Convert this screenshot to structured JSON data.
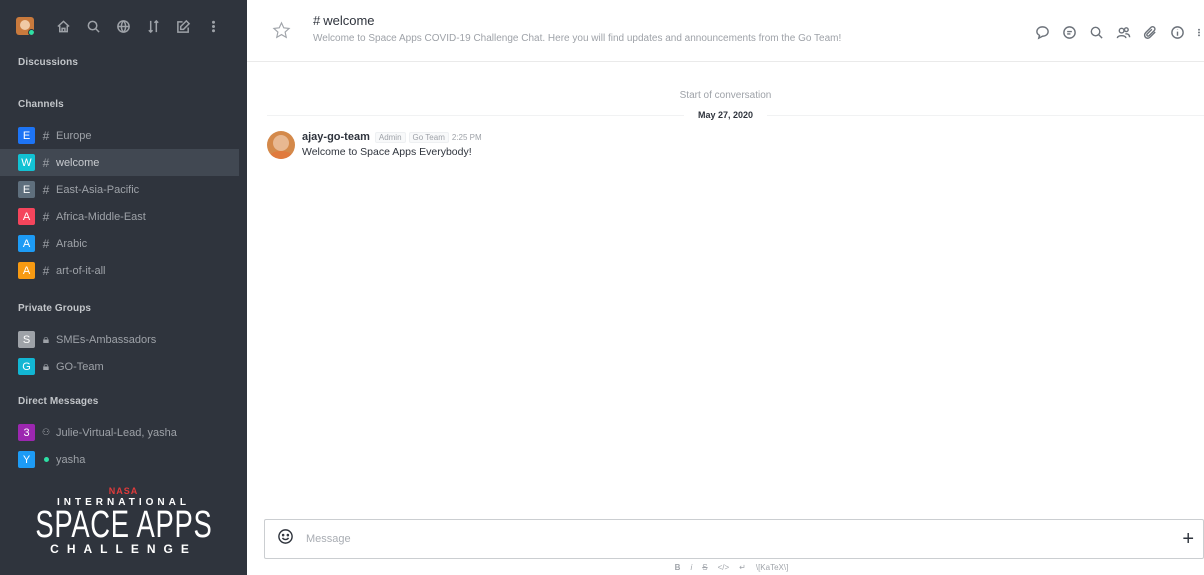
{
  "sidebar": {
    "sections": {
      "discussions": "Discussions",
      "channels": "Channels",
      "private_groups": "Private Groups",
      "direct_messages": "Direct Messages"
    },
    "channels": [
      {
        "letter": "E",
        "color": "#1d74f5",
        "name": "Europe"
      },
      {
        "letter": "W",
        "color": "#12c2d3",
        "name": "welcome"
      },
      {
        "letter": "E",
        "color": "#5f6f7d",
        "name": "East-Asia-Pacific"
      },
      {
        "letter": "A",
        "color": "#f5455c",
        "name": "Africa-Middle-East"
      },
      {
        "letter": "A",
        "color": "#1d9bf5",
        "name": "Arabic"
      },
      {
        "letter": "A",
        "color": "#f79a12",
        "name": "art-of-it-all"
      }
    ],
    "private_groups": [
      {
        "letter": "S",
        "color": "#9ea2a8",
        "name": "SMEs-Ambassadors"
      },
      {
        "letter": "G",
        "color": "#12b6d3",
        "name": "GO-Team"
      }
    ],
    "direct_messages": [
      {
        "letter": "3",
        "color": "#9c27b0",
        "name": "Julie-Virtual-Lead, yasha"
      },
      {
        "letter": "Y",
        "color": "#1d9bf5",
        "name": "yasha"
      }
    ],
    "logo": {
      "nasa": "NASA",
      "international": "INTERNATIONAL",
      "space_apps": "SPACE APPS",
      "challenge": "CHALLENGE"
    }
  },
  "header": {
    "hash": "#",
    "room_name": "welcome",
    "topic": "Welcome to Space Apps COVID-19 Challenge Chat. Here you will find updates and announcements from the Go Team!"
  },
  "conversation": {
    "start_label": "Start of conversation",
    "date": "May 27, 2020",
    "messages": [
      {
        "user": "ajay-go-team",
        "tags": [
          "Admin",
          "Go Team"
        ],
        "time": "2:25 PM",
        "text": "Welcome to Space Apps Everybody!"
      }
    ]
  },
  "composer": {
    "placeholder": "Message",
    "formatting": [
      "B",
      "i",
      "S",
      "</>",
      "↵",
      "\\[KaTeX\\]"
    ]
  },
  "colors": {
    "sidebar_bg": "#2f343d",
    "online": "#2de0a5"
  }
}
